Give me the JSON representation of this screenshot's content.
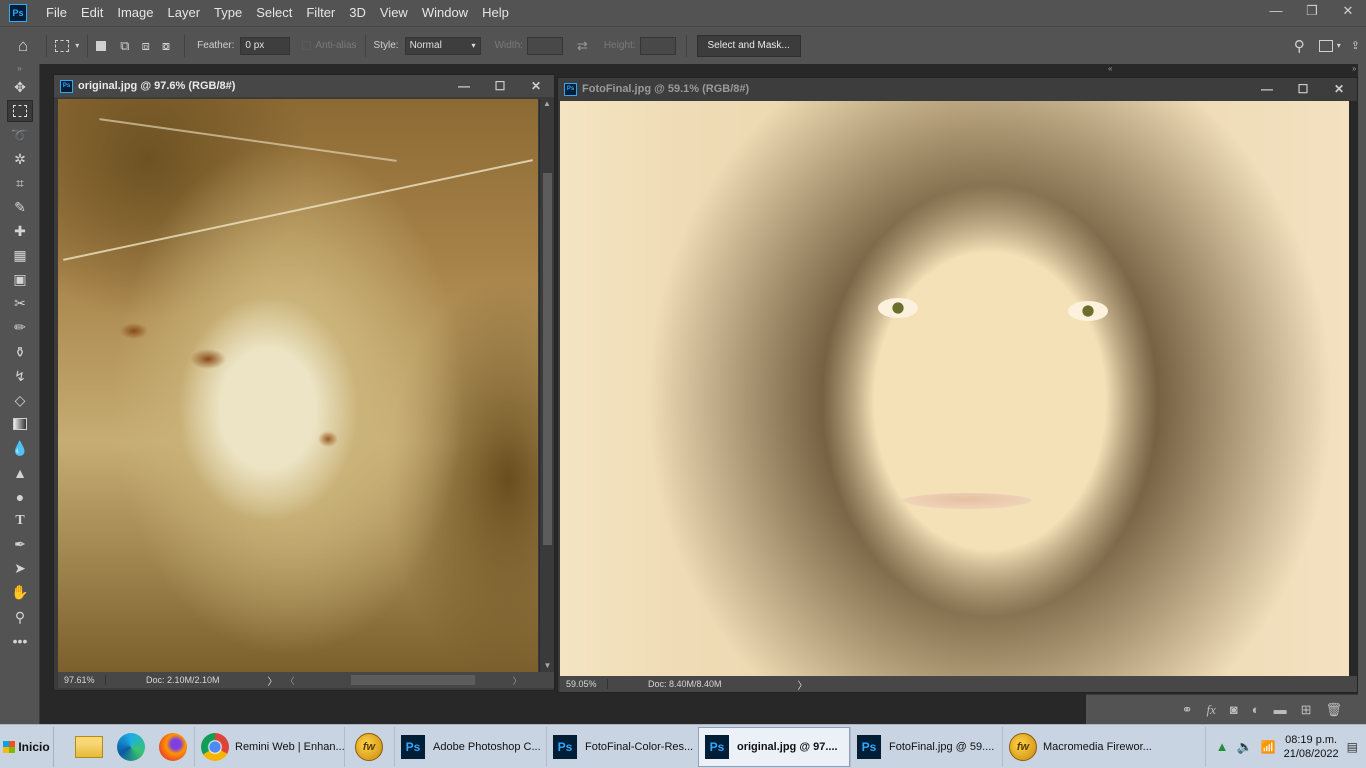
{
  "app": {
    "logo": "Ps",
    "menu": [
      "File",
      "Edit",
      "Image",
      "Layer",
      "Type",
      "Select",
      "Filter",
      "3D",
      "View",
      "Window",
      "Help"
    ],
    "window_controls": {
      "minimize": "—",
      "restore": "❐",
      "close": "✕"
    }
  },
  "options_bar": {
    "feather_label": "Feather:",
    "feather_value": "0 px",
    "antialias_label": "Anti-alias",
    "style_label": "Style:",
    "style_value": "Normal",
    "width_label": "Width:",
    "height_label": "Height:",
    "select_mask_label": "Select and Mask..."
  },
  "toolbar": {
    "tools": [
      "move-tool",
      "rectangular-marquee-tool",
      "lasso-tool",
      "magic-wand-tool",
      "crop-tool",
      "eyedropper-tool",
      "spot-healing-tool",
      "patch-tool",
      "content-aware-move-tool",
      "transform-tool",
      "brush-tool",
      "clone-stamp-tool",
      "history-brush-tool",
      "eraser-tool",
      "gradient-tool",
      "blur-tool",
      "sharpen-tool",
      "dodge-tool",
      "type-tool",
      "pen-tool",
      "path-selection-tool",
      "hand-tool",
      "zoom-tool",
      "more-tools"
    ],
    "active": "rectangular-marquee-tool"
  },
  "documents": [
    {
      "title": "original.jpg @ 97.6% (RGB/8#)",
      "zoom": "97.61%",
      "doc_size": "Doc: 2.10M/2.10M",
      "active": true
    },
    {
      "title": "FotoFinal.jpg @ 59.1% (RGB/8#)",
      "zoom": "59.05%",
      "doc_size": "Doc: 8.40M/8.40M",
      "active": false
    }
  ],
  "taskbar": {
    "start_label": "Inicio",
    "items": [
      {
        "label": "Remini Web | Enhan...",
        "icon": "chrome-icon"
      },
      {
        "label": "",
        "icon": "fireworks-icon"
      },
      {
        "label": "Adobe Photoshop C...",
        "icon": "photoshop-icon"
      },
      {
        "label": "FotoFinal-Color-Res...",
        "icon": "photoshop-icon"
      },
      {
        "label": "original.jpg @ 97....",
        "icon": "photoshop-icon",
        "active": true
      },
      {
        "label": "FotoFinal.jpg @ 59....",
        "icon": "photoshop-icon"
      },
      {
        "label": "Macromedia Firewor...",
        "icon": "fireworks-icon"
      }
    ],
    "clock_time": "08:19 p.m.",
    "clock_date": "21/08/2022"
  }
}
